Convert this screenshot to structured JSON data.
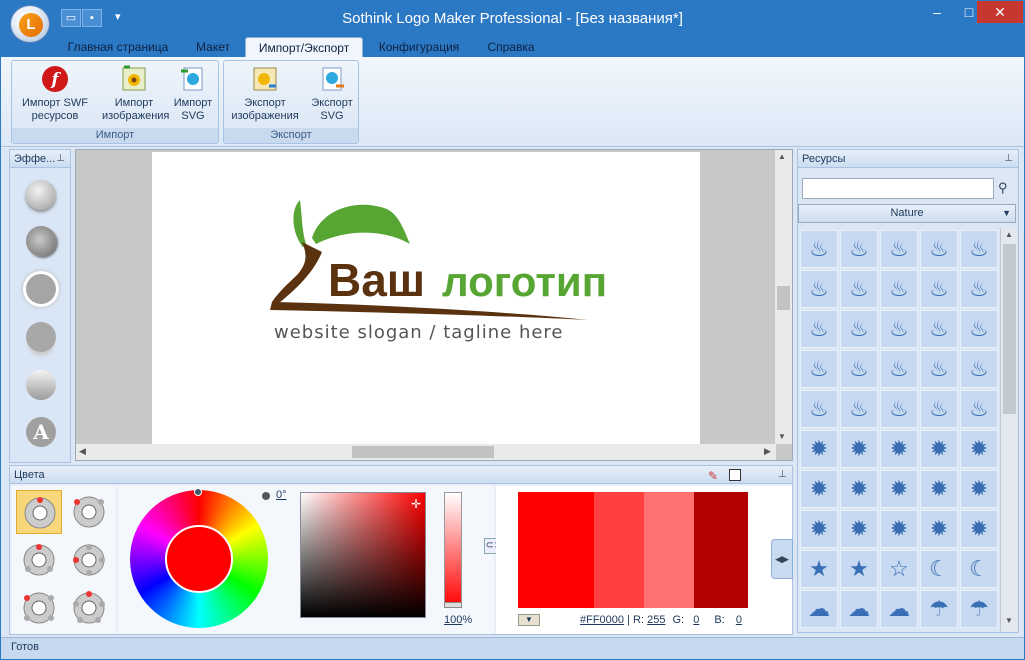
{
  "window": {
    "title": "Sothink Logo Maker Professional - [Без названия*]",
    "minimize": "–",
    "maximize": "□",
    "close": "✕",
    "qat_arrow": "▾"
  },
  "tabs": [
    {
      "label": "Главная страница"
    },
    {
      "label": "Макет"
    },
    {
      "label": "Импорт/Экспорт"
    },
    {
      "label": "Конфигурация"
    },
    {
      "label": "Справка"
    }
  ],
  "ribbon": {
    "import_group": {
      "label": "Импорт",
      "buttons": [
        {
          "label1": "Импорт SWF",
          "label2": "ресурсов"
        },
        {
          "label1": "Импорт",
          "label2": "изображения"
        },
        {
          "label1": "Импорт",
          "label2": "SVG"
        }
      ]
    },
    "export_group": {
      "label": "Экспорт",
      "buttons": [
        {
          "label1": "Экспорт",
          "label2": "изображения"
        },
        {
          "label1": "Экспорт",
          "label2": "SVG"
        }
      ]
    }
  },
  "effects_panel": {
    "title": "Эффе...",
    "text_effect_glyph": "A"
  },
  "logo": {
    "word1": "Ваш",
    "word2": "логотип",
    "slogan": "website slogan / tagline here",
    "brown": "#5a3210",
    "green": "#57a532"
  },
  "colors_panel": {
    "title": "Цвета",
    "angle": "0°",
    "opacity": "100",
    "opacity_unit": "%",
    "hex": "#FF0000",
    "r_label": "R:",
    "r": "255",
    "g_label": "G:",
    "g": "0",
    "b_label": "B:",
    "b": "0",
    "swatches": [
      "#ff0000",
      "#ff4040",
      "#ff7070",
      "#b30000"
    ]
  },
  "resources_panel": {
    "title": "Ресурсы",
    "search_value": "",
    "category": "Nature",
    "icon_color": "#3a6fb5",
    "rows": [
      [
        "♨",
        "♨",
        "♨",
        "♨",
        "♨"
      ],
      [
        "♨",
        "♨",
        "♨",
        "♨",
        "♨"
      ],
      [
        "♨",
        "♨",
        "♨",
        "♨",
        "♨"
      ],
      [
        "♨",
        "♨",
        "♨",
        "♨",
        "♨"
      ],
      [
        "♨",
        "♨",
        "♨",
        "♨",
        "♨"
      ],
      [
        "✹",
        "✹",
        "✹",
        "✹",
        "✹"
      ],
      [
        "✹",
        "✹",
        "✹",
        "✹",
        "✹"
      ],
      [
        "✹",
        "✹",
        "✹",
        "✹",
        "✹"
      ],
      [
        "★",
        "★",
        "☆",
        "☾",
        "☾"
      ],
      [
        "☁",
        "☁",
        "☁",
        "☂",
        "☂"
      ]
    ]
  },
  "status": {
    "text": "Готов"
  }
}
